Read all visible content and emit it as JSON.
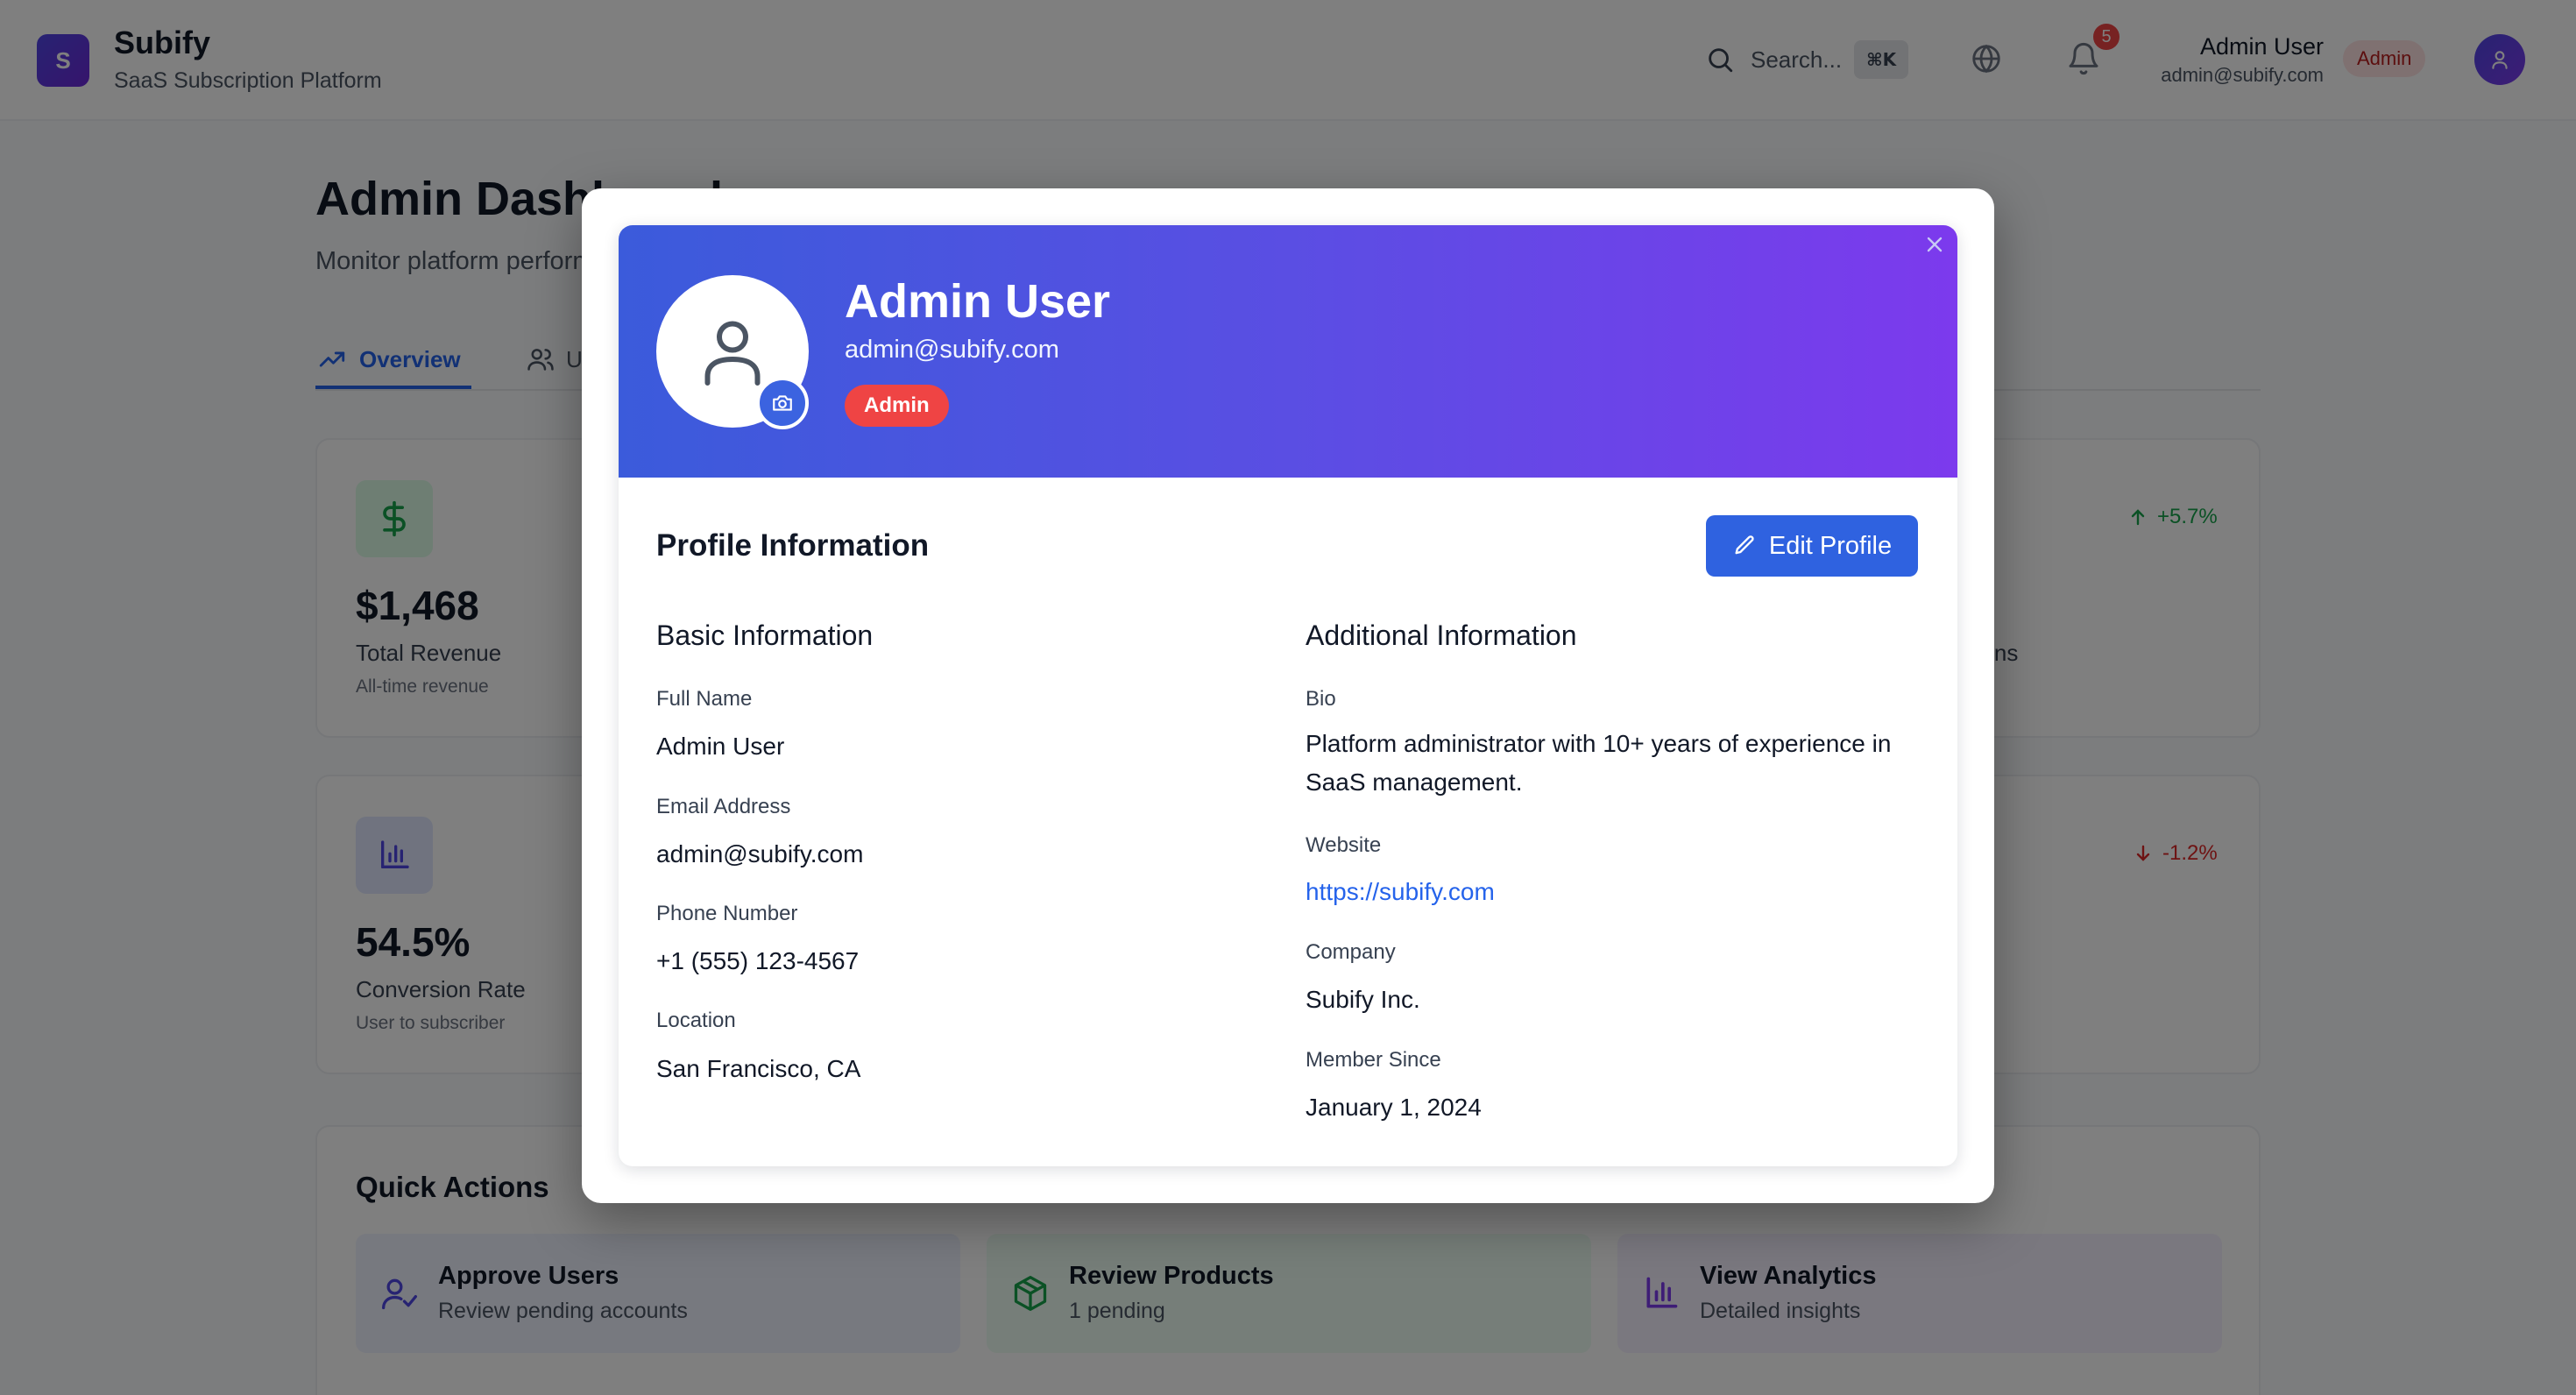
{
  "header": {
    "logo_letter": "S",
    "brand": "Subify",
    "tagline": "SaaS Subscription Platform",
    "search_placeholder": "Search...",
    "search_shortcut": "⌘K",
    "notification_count": "5",
    "user_name": "Admin User",
    "user_email": "admin@subify.com",
    "user_role": "Admin"
  },
  "dashboard": {
    "title": "Admin Dashboard",
    "subtitle": "Monitor platform performance",
    "tabs": [
      {
        "label": "Overview",
        "active": true
      },
      {
        "label": "Users",
        "active": false
      }
    ],
    "stats": [
      {
        "value": "$1,468",
        "label": "Total Revenue",
        "hint": "All-time revenue",
        "icon": "dollar-icon"
      },
      {
        "value": "54.5%",
        "label": "Conversion Rate",
        "hint": "User to subscriber",
        "icon": "bar-chart-icon"
      }
    ],
    "partial_stat_label": "otions",
    "trends": [
      {
        "value": "+5.7%",
        "direction": "up",
        "color": "#16a34a"
      },
      {
        "value": "-1.2%",
        "direction": "down",
        "color": "#dc2626"
      }
    ],
    "quick_actions": {
      "title": "Quick Actions",
      "items": [
        {
          "title": "Approve Users",
          "subtitle": "Review pending accounts",
          "icon": "user-check-icon",
          "bg": "#eef2ff"
        },
        {
          "title": "Review Products",
          "subtitle": "1 pending",
          "icon": "package-icon",
          "bg": "#ecfdf3"
        },
        {
          "title": "View Analytics",
          "subtitle": "Detailed insights",
          "icon": "bar-chart-icon",
          "bg": "#f5f0ff"
        }
      ]
    }
  },
  "profile_modal": {
    "name": "Admin User",
    "email": "admin@subify.com",
    "role": "Admin",
    "section_title": "Profile Information",
    "edit_button": "Edit Profile",
    "basic": {
      "title": "Basic Information",
      "fields": [
        {
          "label": "Full Name",
          "value": "Admin User"
        },
        {
          "label": "Email Address",
          "value": "admin@subify.com"
        },
        {
          "label": "Phone Number",
          "value": "+1 (555) 123-4567"
        },
        {
          "label": "Location",
          "value": "San Francisco, CA"
        }
      ]
    },
    "additional": {
      "title": "Additional Information",
      "bio_label": "Bio",
      "bio": "Platform administrator with 10+ years of experience in SaaS management.",
      "website_label": "Website",
      "website": "https://subify.com",
      "company_label": "Company",
      "company": "Subify Inc.",
      "member_since_label": "Member Since",
      "member_since": "January 1, 2024"
    }
  },
  "colors": {
    "primary": "#2563eb",
    "banner_start": "#3b5bdb",
    "banner_end": "#7c3aed",
    "danger": "#ef4444"
  }
}
